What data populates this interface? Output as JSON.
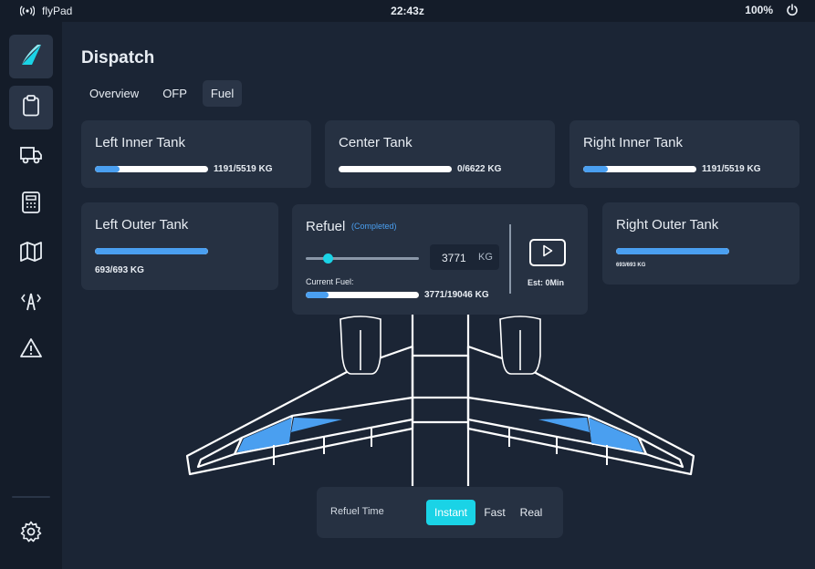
{
  "statusbar": {
    "app_name": "flyPad",
    "time": "22:43z",
    "battery": "100%"
  },
  "sidebar": {
    "items": [
      {
        "name": "logo",
        "icon": "flypad-logo-icon"
      },
      {
        "name": "dispatch",
        "icon": "clipboard-icon"
      },
      {
        "name": "ground",
        "icon": "truck-icon"
      },
      {
        "name": "performance",
        "icon": "calculator-icon"
      },
      {
        "name": "navigation",
        "icon": "map-icon"
      },
      {
        "name": "atc",
        "icon": "antenna-icon"
      },
      {
        "name": "failures",
        "icon": "warning-icon"
      }
    ],
    "settings_icon": "gear-icon"
  },
  "page": {
    "title": "Dispatch",
    "tabs": [
      {
        "label": "Overview",
        "active": false
      },
      {
        "label": "OFP",
        "active": false
      },
      {
        "label": "Fuel",
        "active": true
      }
    ]
  },
  "tanks": {
    "left_inner": {
      "title": "Left Inner Tank",
      "label": "1191/5519 KG",
      "fraction": 0.216
    },
    "center": {
      "title": "Center Tank",
      "label": "0/6622 KG",
      "fraction": 0.0
    },
    "right_inner": {
      "title": "Right Inner Tank",
      "label": "1191/5519 KG",
      "fraction": 0.216
    },
    "left_outer": {
      "title": "Left Outer Tank",
      "label": "693/693 KG",
      "fraction": 1.0
    },
    "right_outer": {
      "title": "Right Outer Tank",
      "label": "693/693 KG",
      "fraction": 1.0
    }
  },
  "refuel": {
    "title": "Refuel",
    "status": "(Completed)",
    "target_value": "3771",
    "target_unit": "KG",
    "slider_fraction": 0.2,
    "current_fuel_label": "Current Fuel:",
    "current_fuel_value": "3771/19046 KG",
    "current_fraction": 0.198,
    "estimate": "Est: 0Min"
  },
  "refuel_time": {
    "label": "Refuel Time",
    "options": [
      {
        "label": "Instant",
        "active": true
      },
      {
        "label": "Fast",
        "active": false
      },
      {
        "label": "Real",
        "active": false
      }
    ]
  },
  "colors": {
    "background": "#1b2535",
    "sidebar": "#141c29",
    "card": "#263142",
    "fuel_fill": "#4a9ff0",
    "accent": "#1ad3e6"
  }
}
